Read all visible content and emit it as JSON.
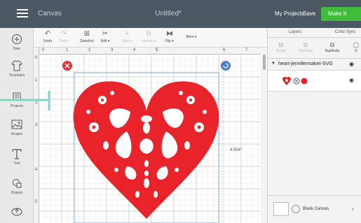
{
  "topbar": {
    "canvas_label": "Canvas",
    "doc_title": "Untitled*",
    "my_projects": "My Projects",
    "save": "Save",
    "make_it": "Make It"
  },
  "sidebar": {
    "items": [
      {
        "label": "New",
        "icon": "plus-circle-icon"
      },
      {
        "label": "Templates",
        "icon": "shirt-icon"
      },
      {
        "label": "Projects",
        "icon": "projects-icon"
      },
      {
        "label": "Images",
        "icon": "image-icon"
      },
      {
        "label": "Text",
        "icon": "text-icon"
      },
      {
        "label": "Shapes",
        "icon": "shapes-icon"
      },
      {
        "label": "",
        "icon": "upload-icon"
      }
    ]
  },
  "toolbar": {
    "undo": "Undo",
    "redo": "Redo",
    "deselect": "Deselect",
    "edit": "Edit ▾",
    "align": "Align ▾",
    "arrange": "Arrange ▾",
    "flip": "Flip ▾",
    "more": "More ▾"
  },
  "canvas": {
    "ruler_top": [
      "0",
      "1",
      "2",
      "3",
      "4",
      "5",
      "6",
      "7"
    ],
    "ruler_left": [
      "0",
      "1",
      "2",
      "3",
      "4",
      "5"
    ],
    "dimension": "4.904\"",
    "colors": {
      "heart": "#e8242a",
      "selection": "#7fa8d8",
      "delete": "#e0343c",
      "rotate": "#4a80c8"
    }
  },
  "panel": {
    "tabs": [
      "Layers",
      "Color Sync"
    ],
    "tools": [
      "Group",
      "UnGroup",
      "Duplicate",
      "D"
    ],
    "layer_group_name": "heart-jennifermaker-SVG",
    "blank_canvas": "Blank Canvas"
  }
}
